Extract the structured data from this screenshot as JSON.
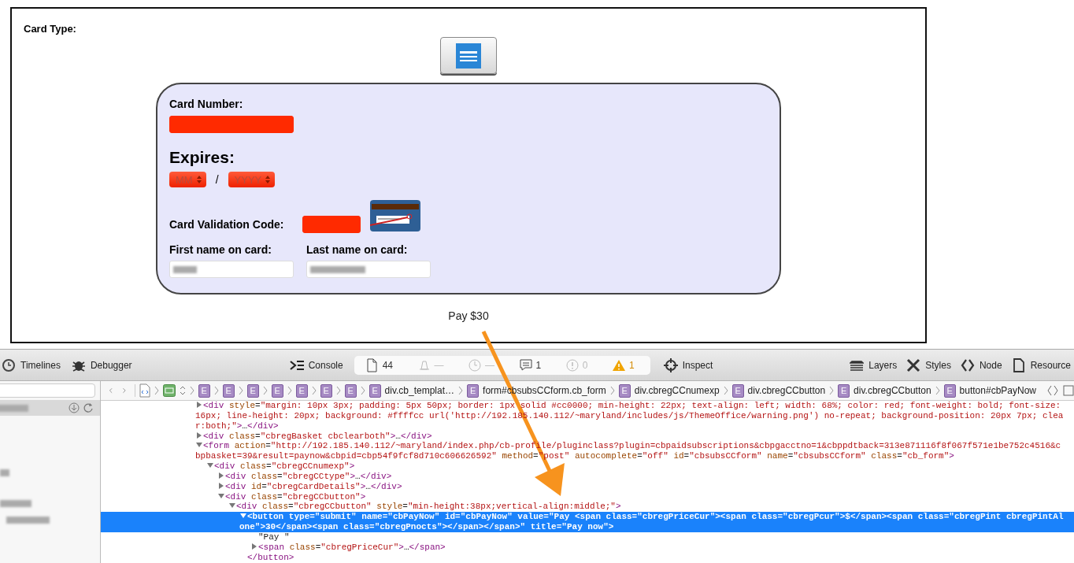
{
  "card_type": {
    "label": "Card Type:"
  },
  "card_form": {
    "card_number": {
      "label": "Card Number:",
      "invalid": true
    },
    "expires": {
      "label": "Expires:",
      "month": {
        "placeholder": "MM",
        "invalid": true
      },
      "separator": "/",
      "year": {
        "placeholder": "YYYY",
        "invalid": true
      }
    },
    "cvc": {
      "label": "Card Validation Code:",
      "invalid": true
    },
    "first_name": {
      "label": "First name on card:",
      "invalid": false
    },
    "last_name": {
      "label": "Last name on card:",
      "invalid": false
    }
  },
  "pay_button": {
    "label": "Pay $30"
  },
  "toolbar": {
    "left": [
      {
        "kind": "timelines",
        "label": "Timelines"
      },
      {
        "kind": "debugger",
        "label": "Debugger"
      }
    ],
    "console": {
      "label": "Console"
    },
    "counters": [
      {
        "kind": "resources",
        "value": "44"
      },
      {
        "kind": "logs",
        "value": "—"
      },
      {
        "kind": "timer",
        "value": "—"
      },
      {
        "kind": "messages",
        "value": "1"
      },
      {
        "kind": "errors",
        "value": "0"
      },
      {
        "kind": "warnings",
        "value": "1"
      }
    ],
    "inspect": {
      "label": "Inspect"
    },
    "right": [
      {
        "kind": "layers",
        "label": "Layers"
      },
      {
        "kind": "styles",
        "label": "Styles"
      },
      {
        "kind": "node",
        "label": "Node"
      },
      {
        "kind": "resource",
        "label": "Resource"
      }
    ]
  },
  "breadcrumbs": [
    {
      "kind": "document"
    },
    {
      "kind": "layout"
    },
    {
      "kind": "element",
      "badge": "E"
    },
    {
      "kind": "element",
      "badge": "E"
    },
    {
      "kind": "element",
      "badge": "E"
    },
    {
      "kind": "element",
      "badge": "E"
    },
    {
      "kind": "element",
      "badge": "E"
    },
    {
      "kind": "element",
      "badge": "E"
    },
    {
      "kind": "element",
      "badge": "E"
    },
    {
      "kind": "element",
      "badge": "E",
      "label": "div.cb_templat…"
    },
    {
      "kind": "element",
      "badge": "E",
      "label": "form#cbsubsCCform.cb_form"
    },
    {
      "kind": "element",
      "badge": "E",
      "label": "div.cbregCCnumexp"
    },
    {
      "kind": "element",
      "badge": "E",
      "label": "div.cbregCCbutton"
    },
    {
      "kind": "element",
      "badge": "E",
      "label": "div.cbregCCbutton"
    },
    {
      "kind": "element",
      "badge": "E",
      "label": "button#cbPayNow"
    }
  ],
  "dom_tree": [
    {
      "markup": "<div style=\"margin: 10px 3px; padding: 5px 50px; border: 1px solid #cc0000; min-height: 22px; text-align: left; width: 68%; color: red; font-weight: bold; font-size: 16px; line-height: 20px; background: #ffffcc url('http://192.185.140.112/~maryland/includes/js/ThemeOffice/warning.png') no-repeat; background-position: 20px 7px; clear:both;\">…</div>",
      "expanded": false,
      "selected": false
    },
    {
      "markup": "<div class=\"cbregBasket cbclearboth\">…</div>",
      "expanded": false,
      "selected": false
    },
    {
      "markup": "<form action=\"http://192.185.140.112/~maryland/index.php/cb-profile/pluginclass?plugin=cbpaidsubscriptions&cbpgacctno=1&cbppdtback=313e871116f8f067f571e1be752c4516&cbpbasket=39&result=paynow&cbpid=cbp54f9fcf8d710c606626592\" method=\"post\" autocomplete=\"off\" id=\"cbsubsCCform\" name=\"cbsubsCCform\" class=\"cb_form\">",
      "expanded": true,
      "selected": false,
      "children": [
        {
          "markup": "<div class=\"cbregCCnumexp\">",
          "expanded": true,
          "selected": false,
          "children": [
            {
              "markup": "<div class=\"cbregCCtype\">…</div>",
              "expanded": false,
              "selected": false
            },
            {
              "markup": "<div id=\"cbregCardDetails\">…</div>",
              "expanded": false,
              "selected": false
            },
            {
              "markup": "<div class=\"cbregCCbutton\">",
              "expanded": true,
              "selected": false,
              "children": [
                {
                  "markup": "<div class=\"cbregCCbutton\" style=\"min-height:38px;vertical-align:middle;\">",
                  "expanded": true,
                  "selected": false,
                  "children": [
                    {
                      "markup": "<button type=\"submit\" name=\"cbPayNow\" id=\"cbPayNow\" value=\"Pay <span class=\"cbregPriceCur\"><span class=\"cbregPcur\">$</span><span class=\"cbregPint cbregPintAlone\">30</span><span class=\"cbregPnocts\"></span></span>\" title=\"Pay now\">",
                      "expanded": true,
                      "selected": true,
                      "closing": "</button>",
                      "children": [
                        {
                          "kind": "text",
                          "markup": "\"Pay \"",
                          "selected": false
                        },
                        {
                          "markup": "<span class=\"cbregPriceCur\">…</span>",
                          "expanded": false,
                          "selected": false
                        }
                      ]
                    }
                  ]
                }
              ]
            }
          ]
        }
      ]
    }
  ]
}
